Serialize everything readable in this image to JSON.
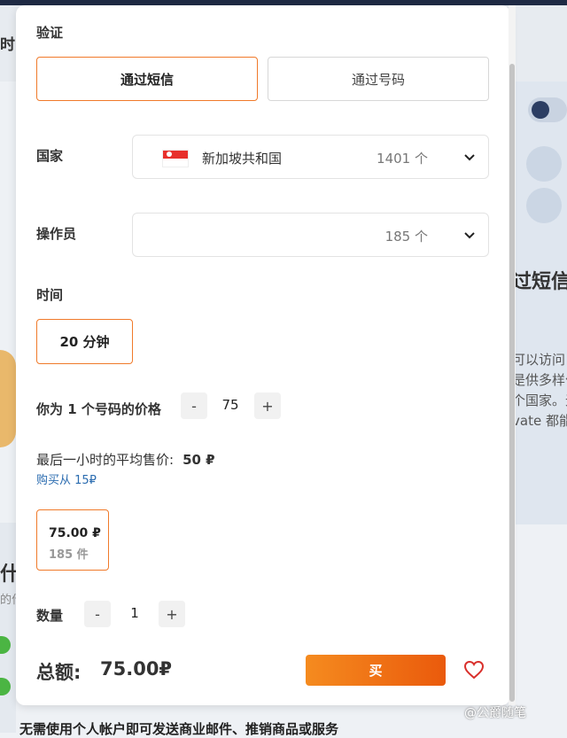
{
  "background": {
    "header_left": "时间",
    "right_title": "过短信",
    "right_lines": [
      "可以访问",
      "是供多样化",
      "个国家。无",
      "vate 都能"
    ],
    "left_heading": "什",
    "left_small": "的什",
    "bottom_text": "无需使用个人帐户即可发送商业邮件、推销商品或服务",
    "watermark": "@公爵随笔"
  },
  "modal": {
    "verification": {
      "label": "验证",
      "options": [
        "通过短信",
        "通过号码"
      ],
      "selected": "通过短信"
    },
    "country": {
      "label": "国家",
      "value": "新加坡共和国",
      "count": "1401 个",
      "flag_icon": "singapore-flag"
    },
    "operator": {
      "label": "操作员",
      "count": "185 个"
    },
    "time": {
      "label": "时间",
      "selected": "20 分钟"
    },
    "price": {
      "label": "你为 1 个号码的价格",
      "value": "75",
      "minus": "-",
      "plus": "+"
    },
    "avg_price": {
      "label": "最后一小时的平均售价:",
      "value": "50 ₽"
    },
    "buy_from": "购买从 15₽",
    "offer": {
      "price": "75.00 ₽",
      "count": "185 件"
    },
    "quantity": {
      "label": "数量",
      "value": "1",
      "minus": "-",
      "plus": "+"
    },
    "total": {
      "label": "总额:",
      "value": "75.00₽"
    },
    "buy_button": "买",
    "colors": {
      "accent": "#f07a2a",
      "button_gradient_start": "#f58b1f",
      "button_gradient_end": "#ea5a0c",
      "link": "#2b6cb0",
      "heart": "#d9302c"
    }
  }
}
